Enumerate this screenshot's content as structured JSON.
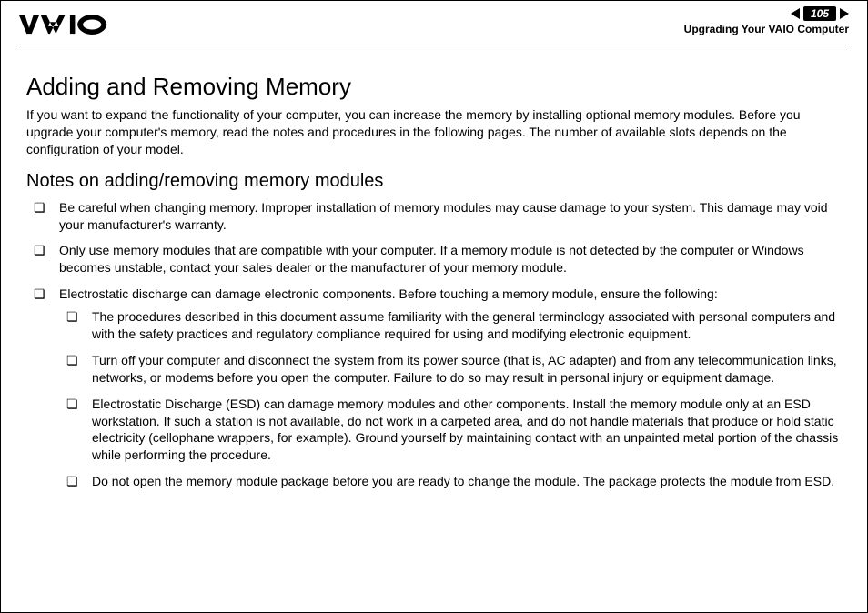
{
  "header": {
    "page_number": "105",
    "breadcrumb": "Upgrading Your VAIO Computer"
  },
  "title": "Adding and Removing Memory",
  "intro": "If you want to expand the functionality of your computer, you can increase the memory by installing optional memory modules. Before you upgrade your computer's memory, read the notes and procedures in the following pages. The number of available slots depends on the configuration of your model.",
  "subtitle": "Notes on adding/removing memory modules",
  "bullets": [
    "Be careful when changing memory. Improper installation of memory modules may cause damage to your system. This damage may void your manufacturer's warranty.",
    "Only use memory modules that are compatible with your computer. If a memory module is not detected by the computer or Windows becomes unstable, contact your sales dealer or the manufacturer of your memory module.",
    "Electrostatic discharge can damage electronic components. Before touching a memory module, ensure the following:"
  ],
  "sub_bullets": [
    "The procedures described in this document assume familiarity with the general terminology associated with personal computers and with the safety practices and regulatory compliance required for using and modifying electronic equipment.",
    "Turn off your computer and disconnect the system from its power source (that is, AC adapter) and from any telecommunication links, networks, or modems before you open the computer. Failure to do so may result in personal injury or equipment damage.",
    "Electrostatic Discharge (ESD) can damage memory modules and other components. Install the memory module only at an ESD workstation. If such a station is not available, do not work in a carpeted area, and do not handle materials that produce or hold static electricity (cellophane wrappers, for example). Ground yourself by maintaining contact with an unpainted metal portion of the chassis while performing the procedure.",
    "Do not open the memory module package before you are ready to change the module. The package protects the module from ESD."
  ]
}
